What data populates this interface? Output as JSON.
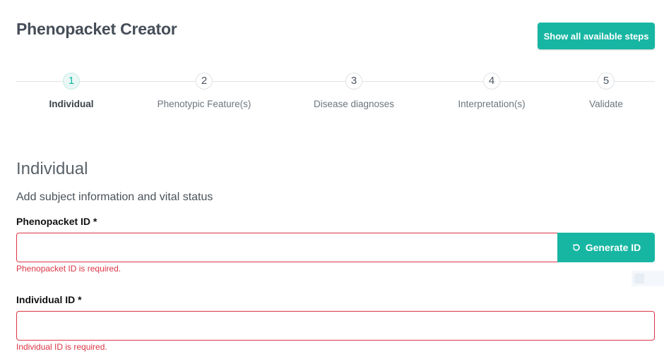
{
  "header": {
    "title": "Phenopacket Creator",
    "show_steps_label": "Show all available steps"
  },
  "stepper": {
    "active_index": 0,
    "steps": [
      {
        "number": "1",
        "label": "Individual"
      },
      {
        "number": "2",
        "label": "Phenotypic Feature(s)"
      },
      {
        "number": "3",
        "label": "Disease diagnoses"
      },
      {
        "number": "4",
        "label": "Interpretation(s)"
      },
      {
        "number": "5",
        "label": "Validate"
      }
    ]
  },
  "section": {
    "title": "Individual",
    "subtitle": "Add subject information and vital status"
  },
  "form": {
    "phenopacket_id": {
      "label": "Phenopacket ID *",
      "value": "",
      "error": "Phenopacket ID is required.",
      "generate_label": "Generate ID",
      "generate_icon": "refresh-icon"
    },
    "individual_id": {
      "label": "Individual ID *",
      "value": "",
      "error": "Individual ID is required."
    }
  },
  "colors": {
    "accent": "#17b6a2",
    "error": "#dc3545"
  }
}
